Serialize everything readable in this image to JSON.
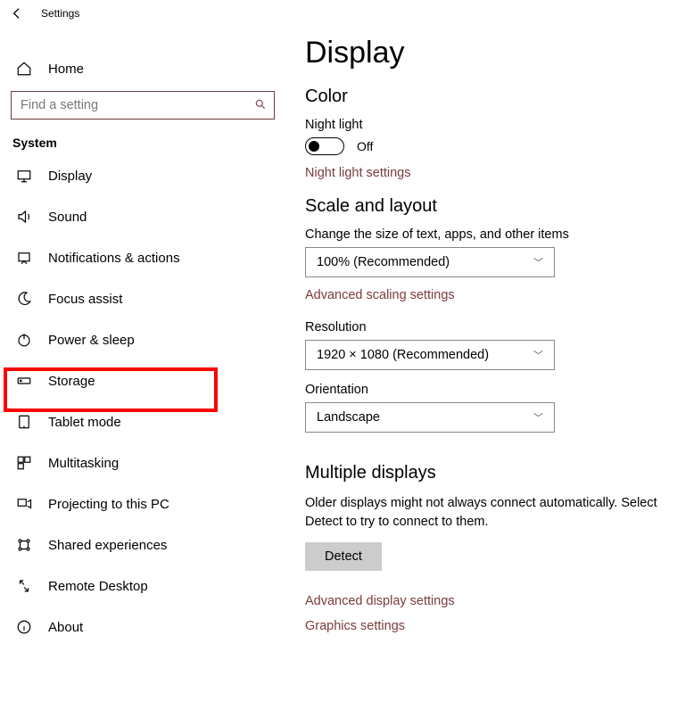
{
  "window": {
    "title": "Settings"
  },
  "sidebar": {
    "home": "Home",
    "search_placeholder": "Find a setting",
    "section": "System",
    "items": [
      {
        "label": "Display"
      },
      {
        "label": "Sound"
      },
      {
        "label": "Notifications & actions"
      },
      {
        "label": "Focus assist"
      },
      {
        "label": "Power & sleep"
      },
      {
        "label": "Storage"
      },
      {
        "label": "Tablet mode"
      },
      {
        "label": "Multitasking"
      },
      {
        "label": "Projecting to this PC"
      },
      {
        "label": "Shared experiences"
      },
      {
        "label": "Remote Desktop"
      },
      {
        "label": "About"
      }
    ]
  },
  "main": {
    "title": "Display",
    "color_heading": "Color",
    "night_light_label": "Night light",
    "night_light_state": "Off",
    "night_light_link": "Night light settings",
    "scale_heading": "Scale and layout",
    "scale_label": "Change the size of text, apps, and other items",
    "scale_value": "100% (Recommended)",
    "scale_link": "Advanced scaling settings",
    "resolution_label": "Resolution",
    "resolution_value": "1920 × 1080 (Recommended)",
    "orientation_label": "Orientation",
    "orientation_value": "Landscape",
    "multi_heading": "Multiple displays",
    "multi_paragraph": "Older displays might not always connect automatically. Select Detect to try to connect to them.",
    "detect_button": "Detect",
    "adv_display_link": "Advanced display settings",
    "graphics_link": "Graphics settings"
  }
}
